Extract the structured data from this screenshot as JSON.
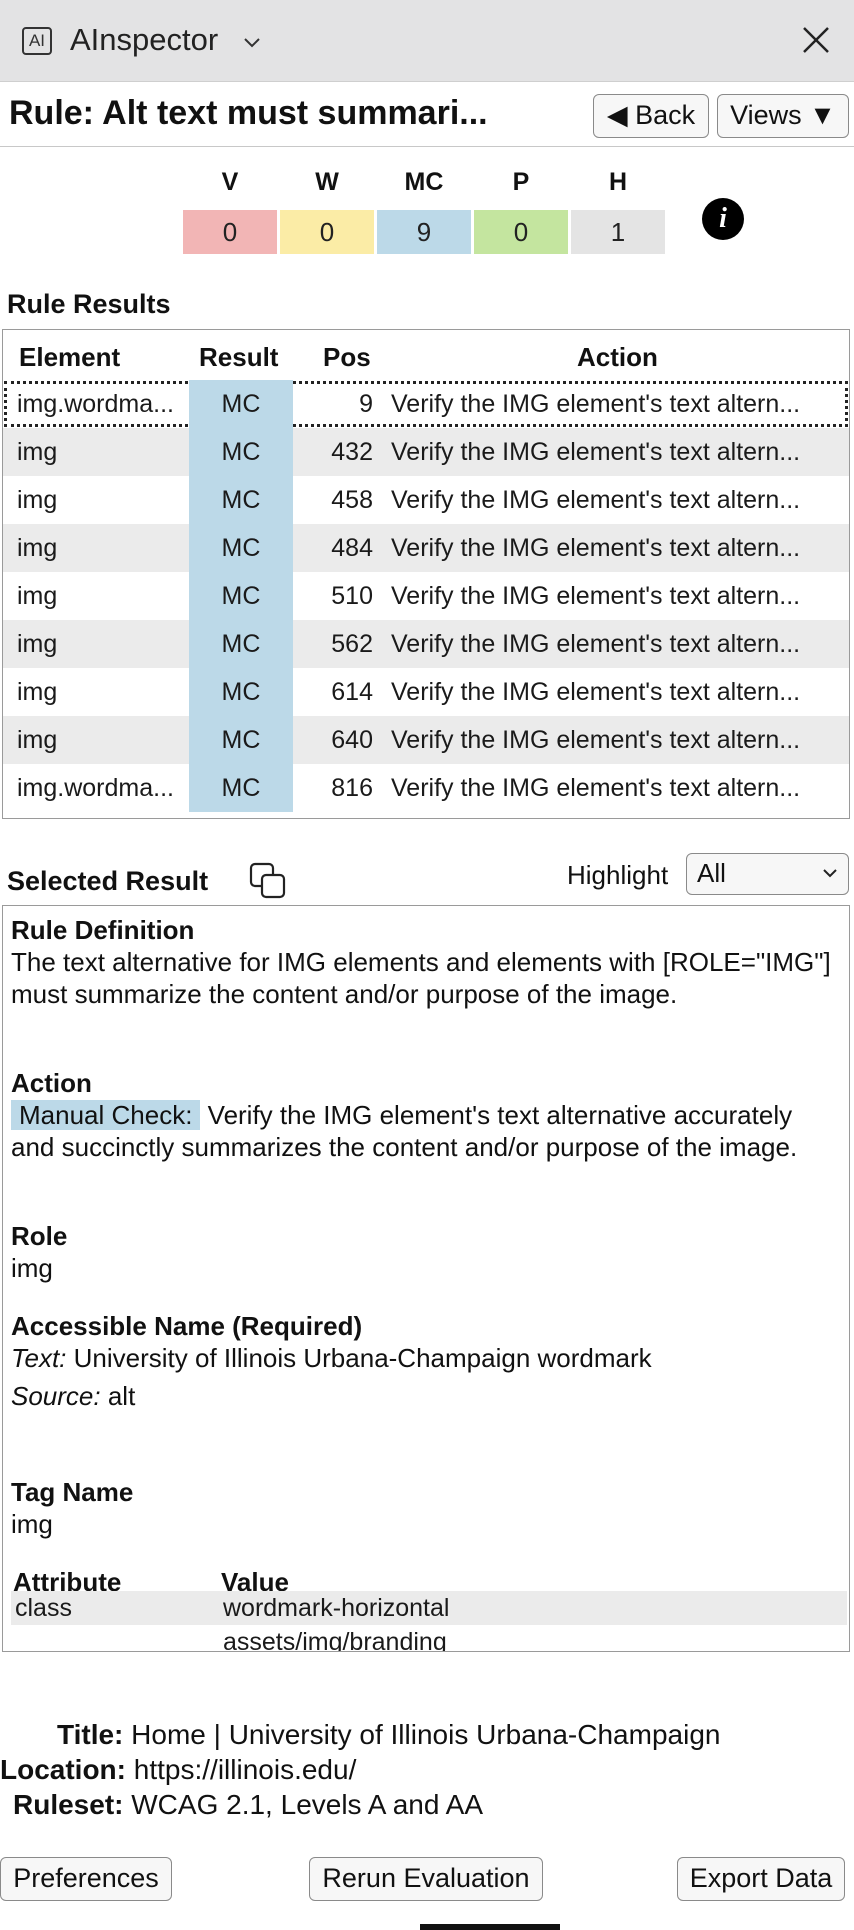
{
  "app": {
    "icon_text": "AI",
    "title": "AInspector",
    "chevron": "⌵",
    "close": "×"
  },
  "rule": {
    "title": "Rule: Alt text must summari...",
    "back_label": "◀ Back",
    "views_label": "Views ▼"
  },
  "summary": {
    "headers": [
      "V",
      "W",
      "MC",
      "P",
      "H"
    ],
    "counts": [
      "0",
      "0",
      "9",
      "0",
      "1"
    ],
    "colors": [
      "#f2b5b5",
      "#fbeca6",
      "#bcd9e8",
      "#c4e59f",
      "#e4e4e4"
    ]
  },
  "rule_results": {
    "heading": "Rule Results",
    "columns": [
      "Element",
      "Result",
      "Pos",
      "Action"
    ],
    "rows": [
      {
        "element": "img.wordma...",
        "result": "MC",
        "pos": "9",
        "action": "Verify the IMG element's text altern..."
      },
      {
        "element": "img",
        "result": "MC",
        "pos": "432",
        "action": "Verify the IMG element's text altern..."
      },
      {
        "element": "img",
        "result": "MC",
        "pos": "458",
        "action": "Verify the IMG element's text altern..."
      },
      {
        "element": "img",
        "result": "MC",
        "pos": "484",
        "action": "Verify the IMG element's text altern..."
      },
      {
        "element": "img",
        "result": "MC",
        "pos": "510",
        "action": "Verify the IMG element's text altern..."
      },
      {
        "element": "img",
        "result": "MC",
        "pos": "562",
        "action": "Verify the IMG element's text altern..."
      },
      {
        "element": "img",
        "result": "MC",
        "pos": "614",
        "action": "Verify the IMG element's text altern..."
      },
      {
        "element": "img",
        "result": "MC",
        "pos": "640",
        "action": "Verify the IMG element's text altern..."
      },
      {
        "element": "img.wordma...",
        "result": "MC",
        "pos": "816",
        "action": "Verify the IMG element's text altern..."
      }
    ]
  },
  "selected_result": {
    "heading": "Selected Result",
    "highlight_label": "Highlight",
    "highlight_value": "All",
    "rule_definition_label": "Rule Definition",
    "rule_definition_text": "The text alternative for IMG elements and elements with [ROLE=\"IMG\"] must summarize the content and/or purpose of the image.",
    "action_label": "Action",
    "action_badge": "Manual Check:",
    "action_text": "Verify the IMG element's text alternative accurately and succinctly summarizes the content and/or purpose of the image.",
    "role_label": "Role",
    "role_value": "img",
    "accessible_name_label": "Accessible Name (Required)",
    "text_label": "Text:",
    "text_value": "University of Illinois Urbana-Champaign wordmark",
    "source_label": "Source:",
    "source_value": "alt",
    "tag_name_label": "Tag Name",
    "tag_name_value": "img",
    "attr_header": "Attribute",
    "value_header": "Value",
    "attributes": [
      {
        "name": "class",
        "value": "wordmark-horizontal"
      },
      {
        "name": "",
        "value": "assets/img/branding"
      }
    ]
  },
  "footer": {
    "title_label": "Title:",
    "title_value": "Home | University of Illinois Urbana-Champaign",
    "location_label": "Location:",
    "location_value": "https://illinois.edu/",
    "ruleset_label": "Ruleset:",
    "ruleset_value": "WCAG 2.1, Levels A and AA",
    "preferences_label": "Preferences",
    "rerun_label": "Rerun Evaluation",
    "export_label": "Export Data"
  }
}
